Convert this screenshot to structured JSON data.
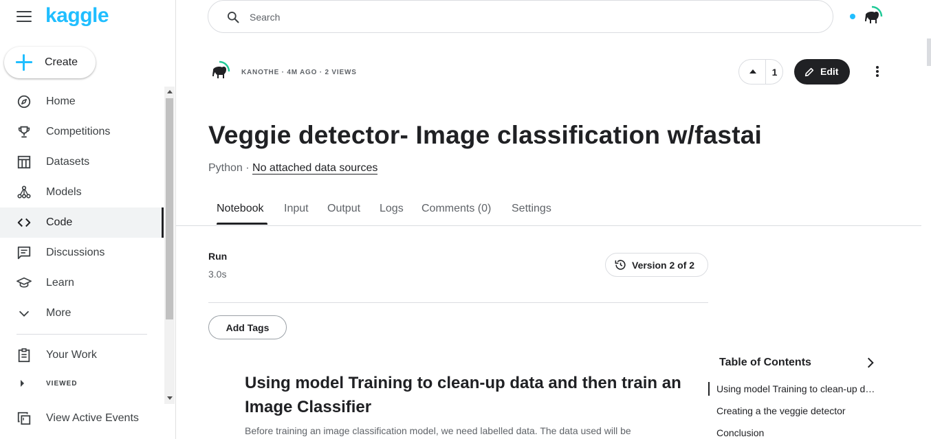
{
  "sidebar": {
    "logo": "kaggle",
    "create_label": "Create",
    "nav": [
      {
        "label": "Home",
        "icon": "compass-icon"
      },
      {
        "label": "Competitions",
        "icon": "trophy-icon"
      },
      {
        "label": "Datasets",
        "icon": "table-icon"
      },
      {
        "label": "Models",
        "icon": "model-icon"
      },
      {
        "label": "Code",
        "icon": "code-icon",
        "active": true
      },
      {
        "label": "Discussions",
        "icon": "discussion-icon"
      },
      {
        "label": "Learn",
        "icon": "graduation-cap-icon"
      },
      {
        "label": "More",
        "icon": "chevron-down-icon"
      }
    ],
    "your_work": "Your Work",
    "viewed": "VIEWED",
    "view_events": "View Active Events"
  },
  "search": {
    "placeholder": "Search"
  },
  "notebook": {
    "meta": "KANOTHE · 4M AGO · 2 VIEWS",
    "upvotes": "1",
    "edit_label": "Edit",
    "title": "Veggie detector- Image classification w/fastai",
    "language": "Python · ",
    "data_sources": "No attached data sources",
    "tabs": [
      "Notebook",
      "Input",
      "Output",
      "Logs",
      "Comments (0)",
      "Settings"
    ],
    "run_label": "Run",
    "run_value": "3.0s",
    "version_label": "Version 2 of 2",
    "add_tags": "Add Tags",
    "heading": "Using model Training to clean-up data and then train an Image Classifier",
    "paragraph": "Before training an image classification model, we need labelled data. The data used will be"
  },
  "toc": {
    "title": "Table of Contents",
    "items": [
      "Using model Training to clean-up data and then train an Image Classifier",
      "Creating a the veggie detector",
      "Conclusion"
    ]
  },
  "colors": {
    "brand": "#20beff",
    "text": "#202124",
    "muted": "#5f6368",
    "edit_button": "#202124"
  }
}
